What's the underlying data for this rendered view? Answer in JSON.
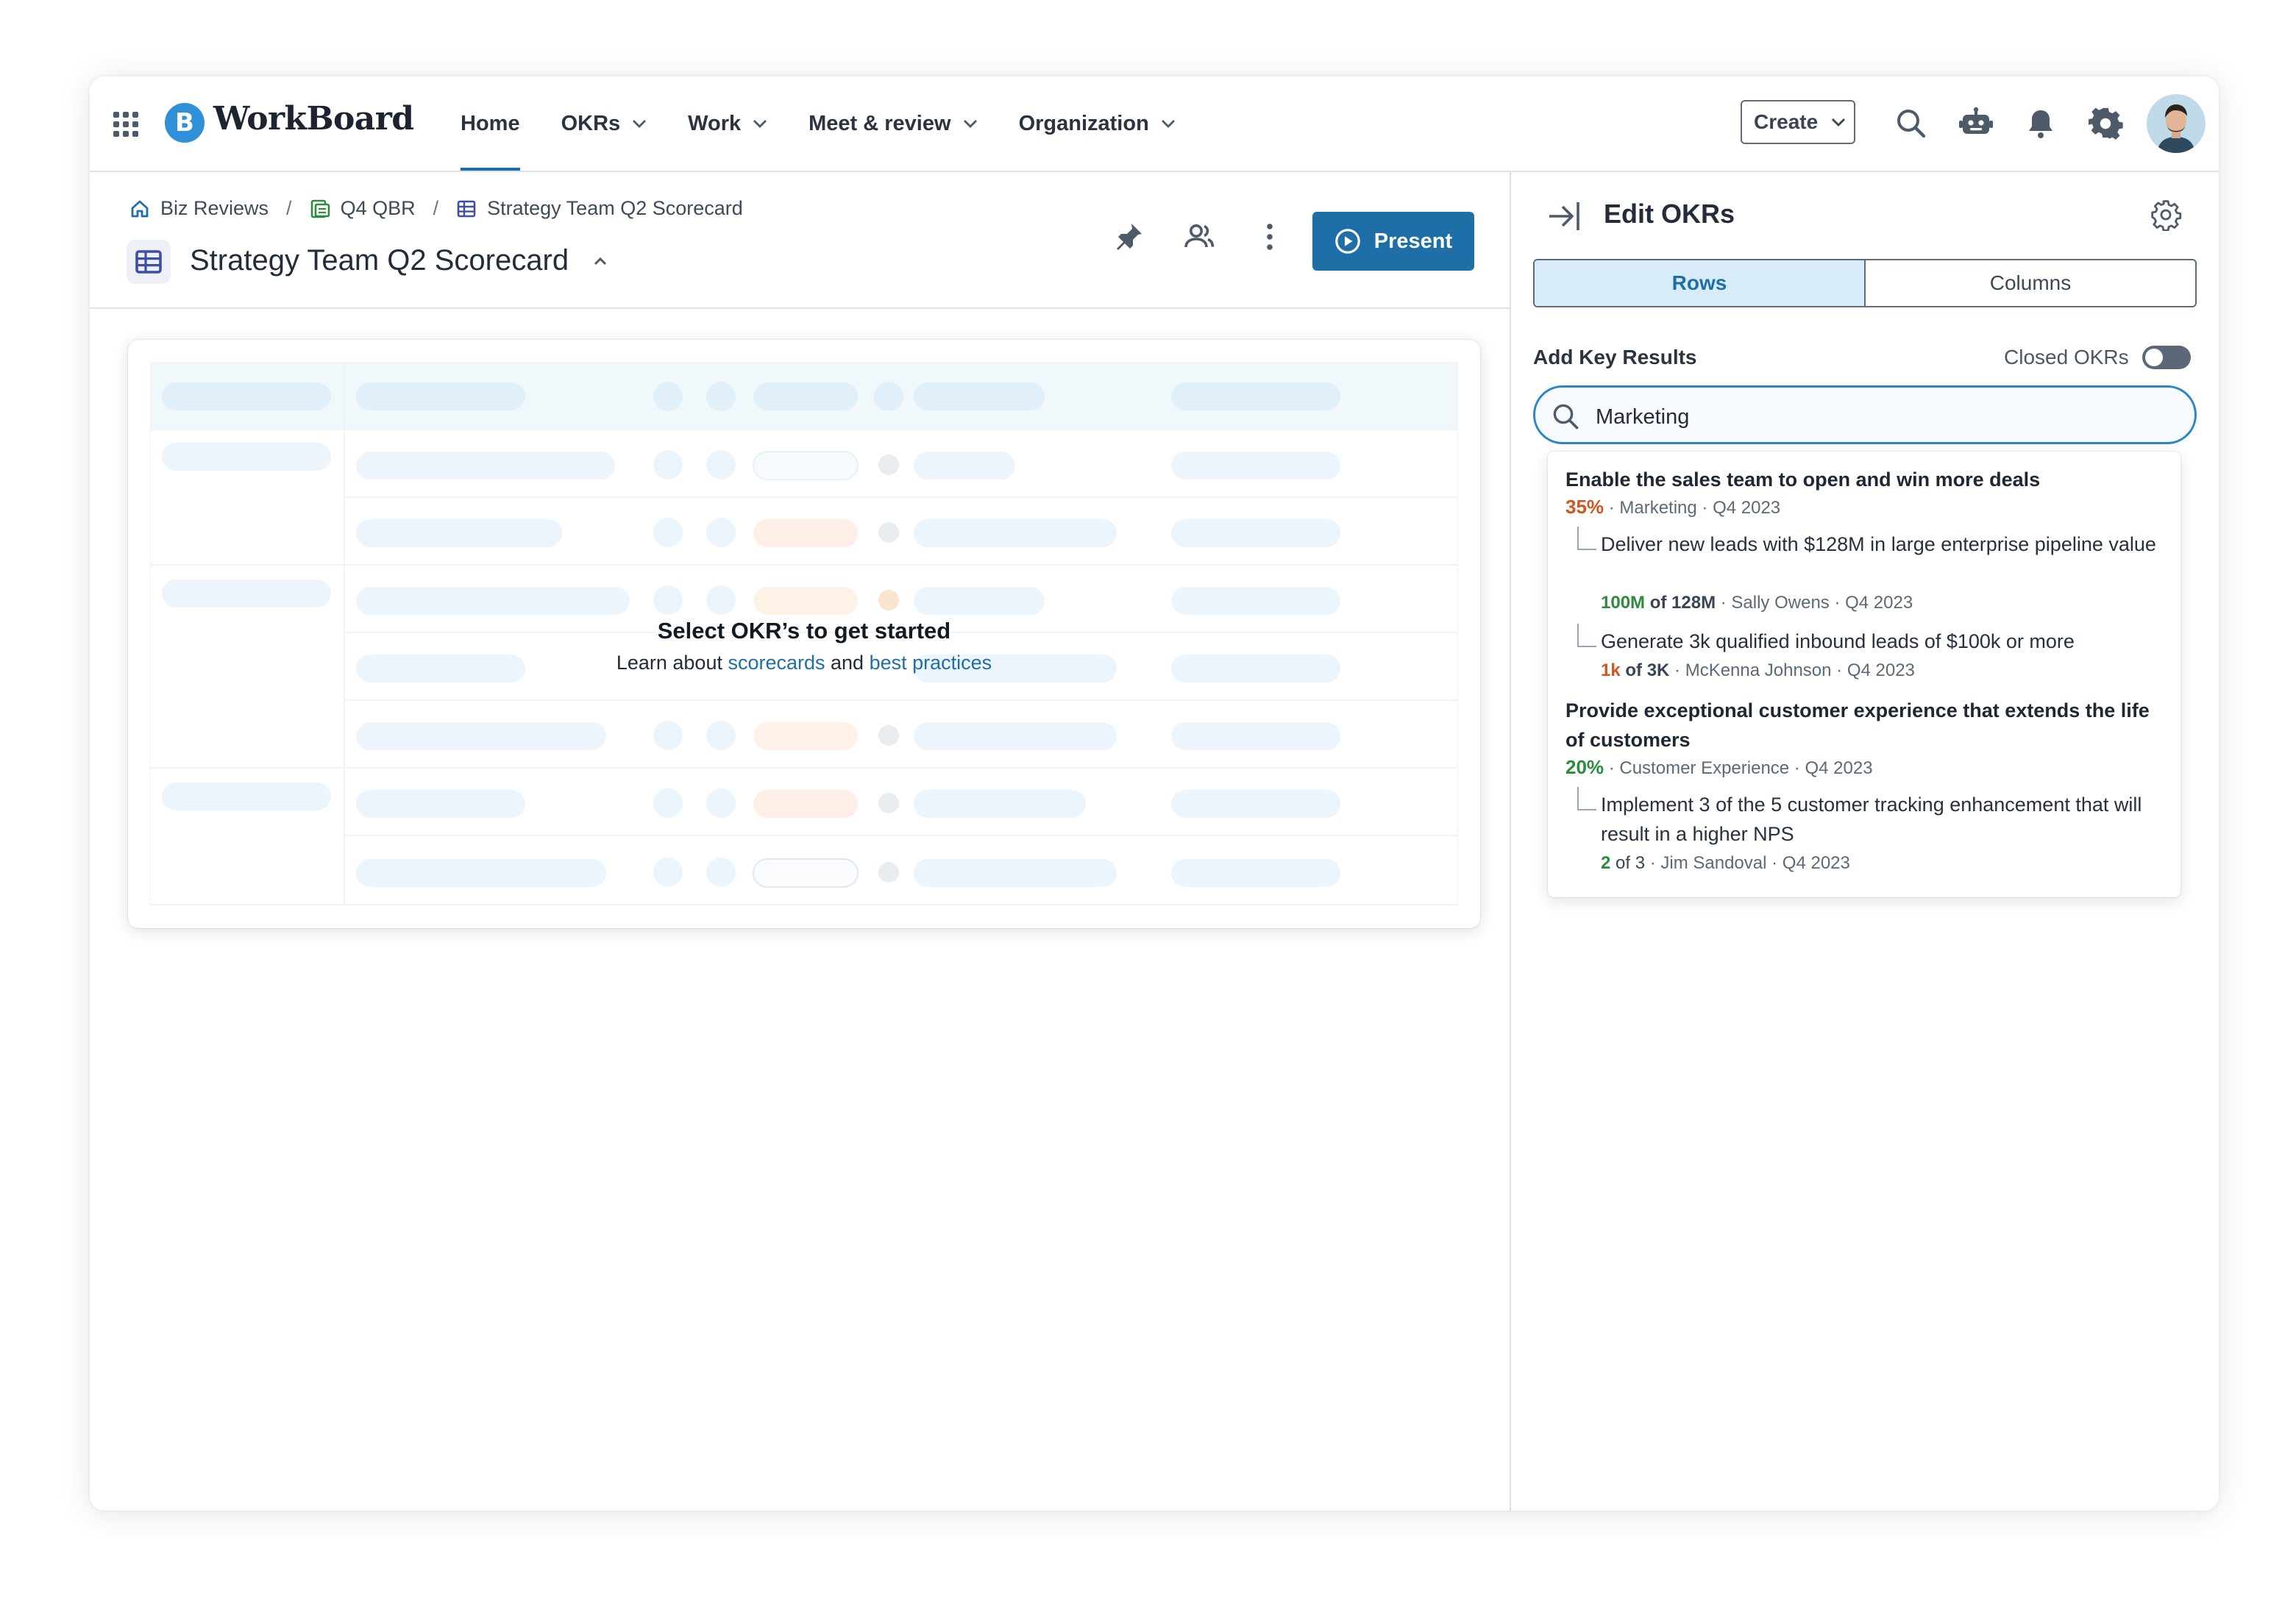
{
  "app": {
    "logo_text": "WorkBoard",
    "logo_letter": "B",
    "colors": {
      "accent": "#1e6fa8",
      "logo": "#2f8fd8",
      "orange": "#d2541f",
      "green": "#2e8b3d"
    }
  },
  "nav": {
    "items": [
      {
        "label": "Home",
        "active": true
      },
      {
        "label": "OKRs",
        "dropdown": true
      },
      {
        "label": "Work",
        "dropdown": true
      },
      {
        "label": "Meet & review",
        "dropdown": true
      },
      {
        "label": "Organization",
        "dropdown": true
      }
    ],
    "create_label": "Create",
    "icons": [
      "search-icon",
      "bot-icon",
      "bell-icon",
      "gear-icon",
      "avatar"
    ]
  },
  "breadcrumbs": [
    {
      "label": "Biz Reviews",
      "icon": "home-icon"
    },
    {
      "label": "Q4 QBR",
      "icon": "report-icon"
    },
    {
      "label": "Strategy Team Q2 Scorecard",
      "icon": "table-icon"
    }
  ],
  "page": {
    "title": "Strategy Team Q2 Scorecard",
    "present_label": "Present"
  },
  "empty_state": {
    "title": "Select OKR’s to get started",
    "sub_prefix": "Learn about ",
    "link1": "scorecards",
    "sub_middle": " and ",
    "link2": "best practices"
  },
  "panel": {
    "title": "Edit OKRs",
    "tabs": [
      {
        "label": "Rows",
        "selected": true
      },
      {
        "label": "Columns",
        "selected": false
      }
    ],
    "add_key_results": "Add Key Results",
    "closed_okrs": "Closed OKRs",
    "closed_okrs_on": false,
    "search_value": "Marketing"
  },
  "results": [
    {
      "title": "Enable the sales team to open and win more deals",
      "pct": "35%",
      "team": "Marketing",
      "period": "Q4 2023",
      "key_results": [
        {
          "title": "Deliver new leads with $128M in large enterprise pipeline value",
          "current": "100M",
          "of": "of 128M",
          "owner": "Sally Owens",
          "period": "Q4 2023"
        },
        {
          "title": "Generate 3k qualified inbound leads of $100k or more",
          "current": "1k",
          "of": "of 3K",
          "owner": "McKenna Johnson",
          "period": "Q4 2023"
        }
      ]
    },
    {
      "title": "Provide exceptional customer experience that extends the life of customers",
      "pct": "20%",
      "team": "Customer Experience",
      "period": "Q4 2023",
      "key_results": [
        {
          "title": "Implement 3 of the 5 customer tracking enhancement that will result in a higher NPS",
          "current": "2",
          "of": "of 3",
          "owner": "Jim Sandoval",
          "period": "Q4 2023"
        }
      ]
    }
  ]
}
